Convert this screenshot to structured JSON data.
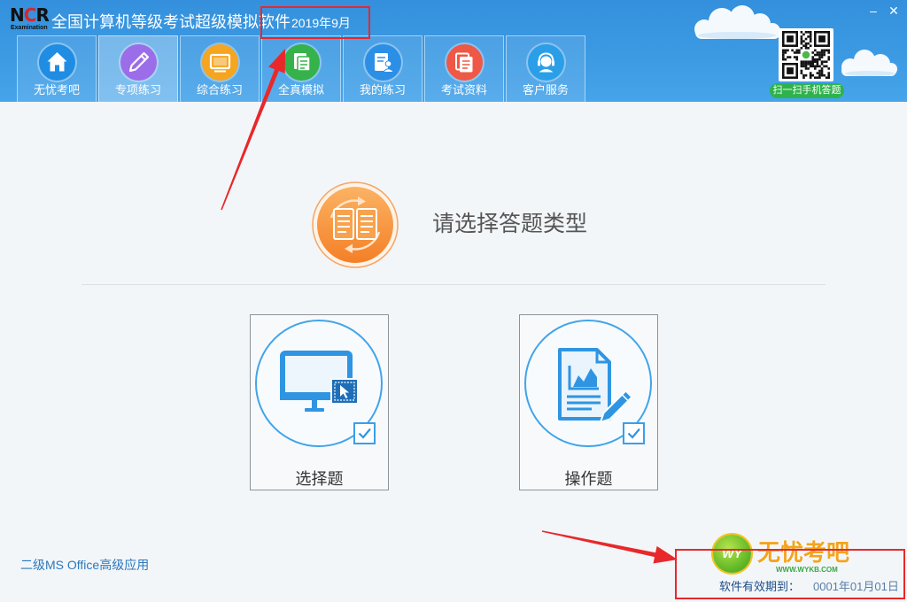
{
  "window": {
    "logo": {
      "mark": [
        "N",
        "C",
        "R"
      ],
      "tagline": "Examination"
    },
    "title": "全国计算机等级考试超级模拟软件",
    "title_date": "2019年9月",
    "controls": {
      "minimize": "–",
      "close": "✕"
    }
  },
  "nav": {
    "items": [
      {
        "label": "无忧考吧",
        "icon": "home-icon",
        "color": "#1f8de4",
        "selected": false
      },
      {
        "label": "专项练习",
        "icon": "pencil-icon",
        "color": "#9c6de8",
        "selected": true
      },
      {
        "label": "综合练习",
        "icon": "screen-icon",
        "color": "#f5a51f",
        "selected": false
      },
      {
        "label": "全真模拟",
        "icon": "mock-exam-icon",
        "color": "#36b24b",
        "selected": false
      },
      {
        "label": "我的练习",
        "icon": "my-practice-icon",
        "color": "#2c8fe6",
        "selected": false
      },
      {
        "label": "考试资料",
        "icon": "exam-materials-icon",
        "color": "#ef5846",
        "selected": false
      },
      {
        "label": "客户服务",
        "icon": "headset-icon",
        "color": "#2a9fe8",
        "selected": false
      }
    ]
  },
  "qr": {
    "icon": "qr-code-icon",
    "label": "扫一扫手机答题"
  },
  "main": {
    "prompt_icon": "document-switch-icon",
    "prompt": "请选择答题类型",
    "cards": [
      {
        "label": "选择题",
        "icon": "monitor-icon",
        "checked": true
      },
      {
        "label": "操作题",
        "icon": "document-chart-icon",
        "checked": true
      }
    ]
  },
  "footer": {
    "subject": "二级MS Office高级应用",
    "brand": {
      "badge": "WY",
      "name": "无忧考吧",
      "url": "WWW.WYKB.COM"
    },
    "expiry_label": "软件有效期到：",
    "expiry_value": "0001年01月01日"
  },
  "colors": {
    "header": "#3c9ae3",
    "accent": "#3aa0e8",
    "annotation": "#e8282b",
    "prompt_icon": "#f58a2c",
    "brand": "#f3a41c"
  }
}
